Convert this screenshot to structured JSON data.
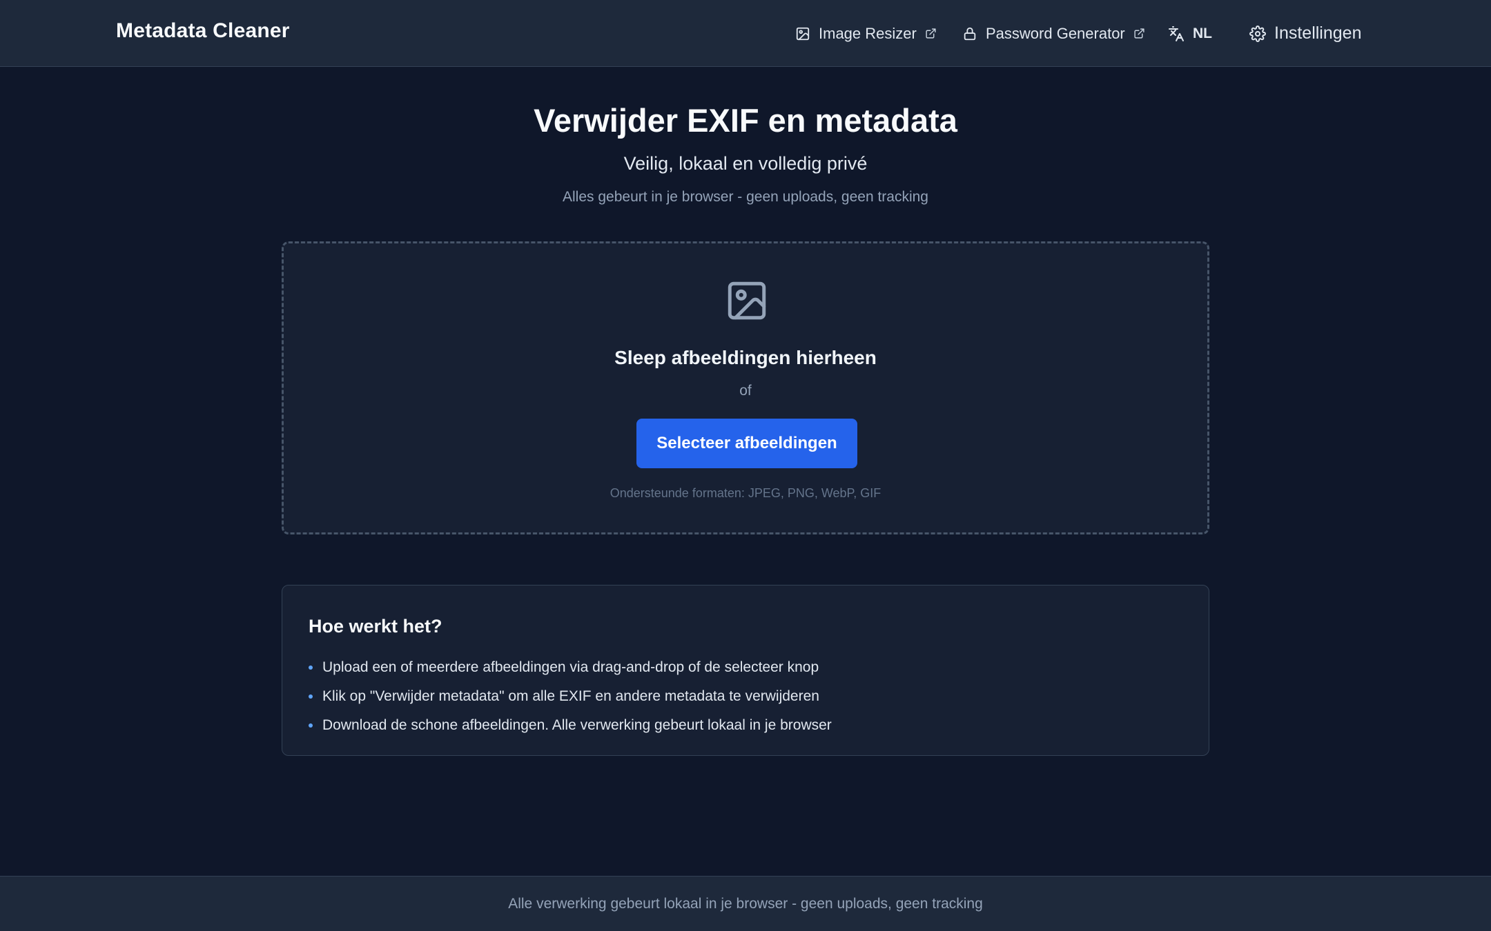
{
  "header": {
    "brand": "Metadata Cleaner",
    "nav": {
      "image_resizer": "Image Resizer",
      "password_generator": "Password Generator",
      "language": "NL",
      "settings": "Instellingen"
    }
  },
  "hero": {
    "title": "Verwijder EXIF en metadata",
    "subtitle": "Veilig, lokaal en volledig privé",
    "note": "Alles gebeurt in je browser - geen uploads, geen tracking"
  },
  "dropzone": {
    "title": "Sleep afbeeldingen hierheen",
    "or": "of",
    "button": "Selecteer afbeeldingen",
    "formats": "Ondersteunde formaten: JPEG, PNG, WebP, GIF"
  },
  "howto": {
    "title": "Hoe werkt het?",
    "items": [
      "Upload een of meerdere afbeeldingen via drag-and-drop of de selecteer knop",
      "Klik op \"Verwijder metadata\" om alle EXIF en andere metadata te verwijderen",
      "Download de schone afbeeldingen. Alle verwerking gebeurt lokaal in je browser"
    ]
  },
  "footer": {
    "text": "Alle verwerking gebeurt lokaal in je browser - geen uploads, geen tracking"
  },
  "colors": {
    "background": "#0f172a",
    "header": "#1e293b",
    "accent": "#2563eb",
    "bullet": "#60a5fa"
  },
  "icons": {
    "image_resizer": "image-icon",
    "external_link": "external-link-icon",
    "password_generator": "lock-icon",
    "language": "translate-icon",
    "settings": "gear-icon",
    "dropzone": "image-icon"
  }
}
